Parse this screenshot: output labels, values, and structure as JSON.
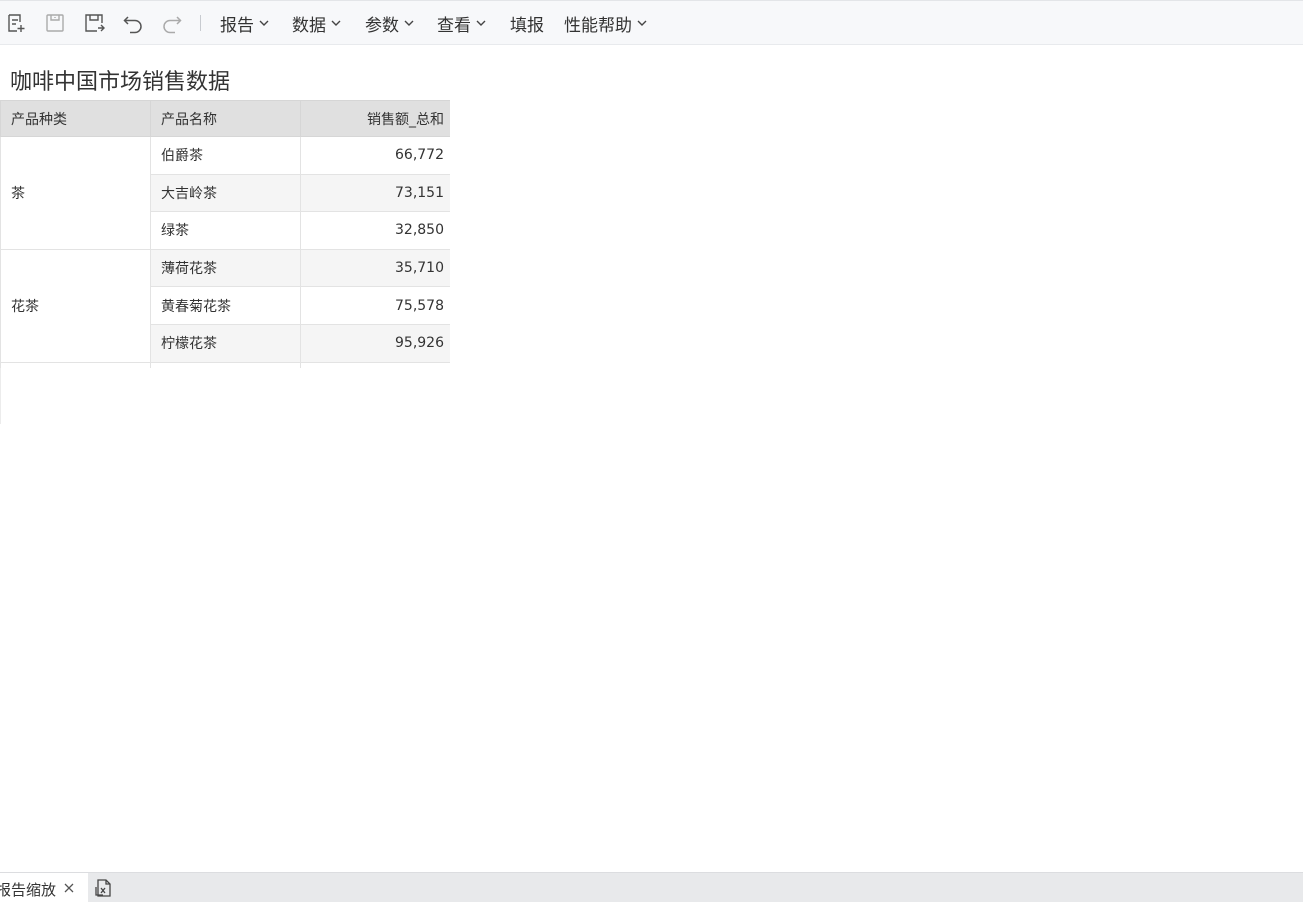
{
  "toolbar": {
    "icons": [
      "new-report-icon",
      "save-icon",
      "save-as-icon",
      "undo-icon",
      "redo-icon"
    ],
    "menus": [
      {
        "label": "报告",
        "has_dropdown": true
      },
      {
        "label": "数据",
        "has_dropdown": true
      },
      {
        "label": "参数",
        "has_dropdown": true
      },
      {
        "label": "查看",
        "has_dropdown": true
      },
      {
        "label": "填报",
        "has_dropdown": false
      },
      {
        "label": "性能帮助",
        "has_dropdown": true
      }
    ]
  },
  "report": {
    "title": "咖啡中国市场销售数据",
    "table": {
      "headers": [
        "产品种类",
        "产品名称",
        "销售额_总和"
      ],
      "groups": [
        {
          "category": "茶",
          "rows": [
            {
              "name": "伯爵茶",
              "value": "66,772"
            },
            {
              "name": "大吉岭茶",
              "value": "73,151"
            },
            {
              "name": "绿茶",
              "value": "32,850"
            }
          ]
        },
        {
          "category": "花茶",
          "rows": [
            {
              "name": "薄荷花茶",
              "value": "35,710"
            },
            {
              "name": "黄春菊花茶",
              "value": "75,578"
            },
            {
              "name": "柠檬花茶",
              "value": "95,926"
            }
          ]
        }
      ]
    }
  },
  "bottom_bar": {
    "tab_label": "报告缩放"
  },
  "colors": {
    "toolbar_bg": "#f7f8fa",
    "header_bg": "#e0e0e0",
    "alt_row_bg": "#f5f5f5",
    "bottom_bar_bg": "#e8e9eb"
  }
}
